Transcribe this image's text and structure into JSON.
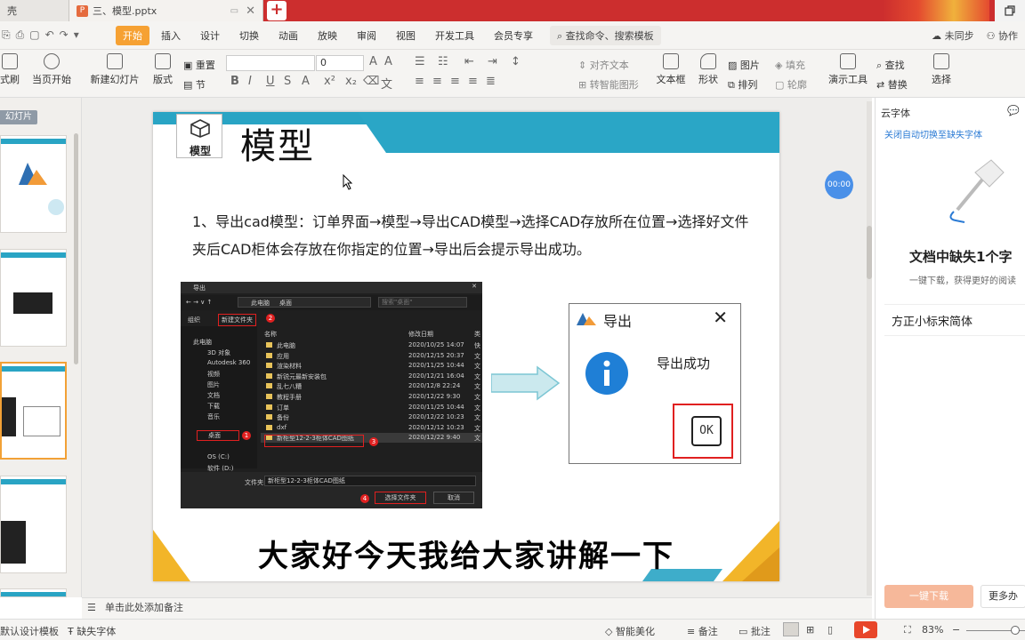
{
  "tabs": [
    {
      "label": "壳",
      "active": false
    },
    {
      "label": "三、模型.pptx",
      "active": true
    }
  ],
  "quick_access": [
    "save-icon",
    "print-icon",
    "preview-icon",
    "undo-icon",
    "redo-icon",
    "dropdown-icon"
  ],
  "menu": {
    "items": [
      "开始",
      "插入",
      "设计",
      "切换",
      "动画",
      "放映",
      "审阅",
      "视图",
      "开发工具",
      "会员专享"
    ],
    "active": "开始",
    "search": "查找命令、搜索模板",
    "sync": "未同步",
    "collab": "协作"
  },
  "ribbon": {
    "format_brush": "式刷",
    "from_current": "当页开始",
    "new_slide": "新建幻灯片",
    "layout": "版式",
    "reset": "重置",
    "section": "节",
    "font_size": "0",
    "align_text": "对齐文本",
    "convert_smartart": "转智能图形",
    "textbox": "文本框",
    "shape": "形状",
    "picture": "图片",
    "arrange": "排列",
    "fill": "填充",
    "outline": "轮廓",
    "presenter": "演示工具",
    "find": "查找",
    "replace": "替换",
    "select": "选择"
  },
  "slides_pane": {
    "label": "幻灯片"
  },
  "slide": {
    "badge_label": "模型",
    "title": "模型",
    "body": "1、导出cad模型：订单界面→模型→导出CAD模型→选择CAD存放所在位置→选择好文件夹后CAD柜体会存放在你指定的位置→导出后会提示导出成功。",
    "subtitle": "大家好今天我给大家讲解一下",
    "timer": "00:00"
  },
  "export_window": {
    "title": "导出",
    "breadcrumb": [
      "此电脑",
      "桌面"
    ],
    "search_placeholder": "搜索\"桌面\"",
    "organize": "组织",
    "new_folder": "新建文件夹",
    "col_name": "名称",
    "col_date": "修改日期",
    "col_type": "类",
    "tree": [
      "此电脑",
      "3D 对象",
      "Autodesk 360",
      "视频",
      "图片",
      "文档",
      "下载",
      "音乐",
      "桌面",
      "OS (C:)",
      "软件 (D:)"
    ],
    "files": [
      {
        "name": "此电脑",
        "date": "2020/10/25 14:07",
        "type": "快"
      },
      {
        "name": "应用",
        "date": "2020/12/15 20:37",
        "type": "文"
      },
      {
        "name": "渲染材料",
        "date": "2020/11/25 10:44",
        "type": "文"
      },
      {
        "name": "新锐元最新安装包",
        "date": "2020/12/21 16:04",
        "type": "文"
      },
      {
        "name": "乱七八糟",
        "date": "2020/12/8 22:24",
        "type": "文"
      },
      {
        "name": "教程手册",
        "date": "2020/12/22 9:30",
        "type": "文"
      },
      {
        "name": "订单",
        "date": "2020/11/25 10:44",
        "type": "文"
      },
      {
        "name": "备份",
        "date": "2020/12/22 10:23",
        "type": "文"
      },
      {
        "name": "dxf",
        "date": "2020/12/12 10:23",
        "type": "文"
      },
      {
        "name": "新柜型12-2-3柜体CAD图纸",
        "date": "2020/12/22 9:40",
        "type": "文"
      }
    ],
    "folder_label": "文件夹:",
    "folder_value": "新柜型12-2-3柜体CAD图纸",
    "select_button": "选择文件夹",
    "cancel_button": "取消",
    "markers": [
      "1",
      "2",
      "3",
      "4"
    ]
  },
  "success_dialog": {
    "title": "导出",
    "message": "导出成功",
    "ok": "OK"
  },
  "notes": {
    "placeholder": "单击此处添加备注"
  },
  "right_pane": {
    "header": "云字体",
    "link": "关闭自动切换至缺失字体",
    "heading": "文档中缺失1个字",
    "sub": "一键下载，获得更好的阅读",
    "font_name": "方正小标宋简体",
    "download_button": "一键下载",
    "more_button": "更多办"
  },
  "status": {
    "template": "默认设计模板",
    "missing_font": "缺失字体",
    "beautify": "智能美化",
    "notes": "备注",
    "comment": "批注",
    "zoom": "83%"
  },
  "colors": {
    "accent": "#29a4c4",
    "brand": "#cc2e2e",
    "active_tab": "#f6a133",
    "highlight": "#e02020"
  }
}
